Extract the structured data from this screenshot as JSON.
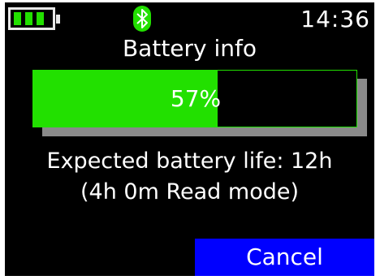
{
  "status_bar": {
    "battery_segments_filled": 3,
    "battery_segments_total": 3,
    "bluetooth_icon": "bluetooth-icon",
    "time": "14:36"
  },
  "title": "Battery info",
  "battery": {
    "percent_value": 57,
    "percent_label": "57%"
  },
  "info": {
    "line1": "Expected battery life: 12h",
    "line2": "(4h 0m Read mode)"
  },
  "buttons": {
    "cancel_label": "Cancel"
  },
  "colors": {
    "screen_background": "#000000",
    "accent_green": "#22e000",
    "button_blue": "#0000ff",
    "text": "#ffffff",
    "bar_shadow": "#8a8a8a"
  }
}
